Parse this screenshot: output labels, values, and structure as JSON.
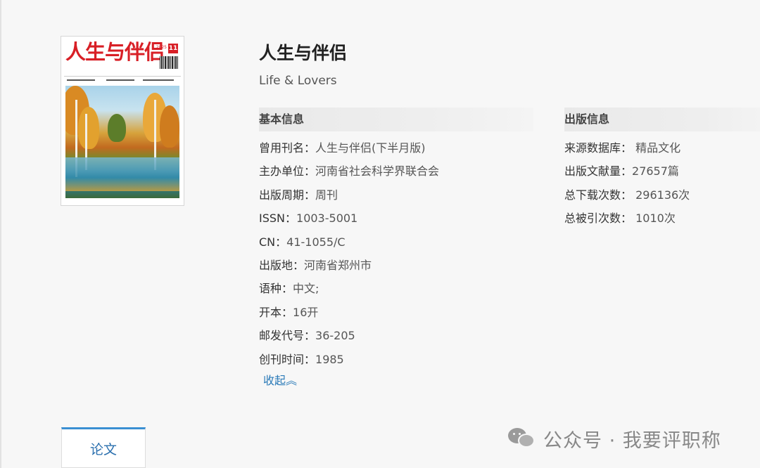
{
  "cover": {
    "masthead": "人生与伴侣",
    "issue": "11",
    "year": "2025"
  },
  "journal": {
    "title": "人生与伴侣",
    "english_title": "Life & Lovers"
  },
  "basic_info": {
    "heading": "基本信息",
    "items": [
      {
        "label": "曾用刊名：",
        "value": "人生与伴侣(下半月版)"
      },
      {
        "label": "主办单位：",
        "value": "河南省社会科学界联合会"
      },
      {
        "label": "出版周期：",
        "value": "周刊"
      },
      {
        "label": "ISSN：",
        "value": "1003-5001"
      },
      {
        "label": "CN：",
        "value": "41-1055/C"
      },
      {
        "label": "出版地：",
        "value": "河南省郑州市"
      },
      {
        "label": "语种：",
        "value": "中文;"
      },
      {
        "label": "开本：",
        "value": "16开"
      },
      {
        "label": "邮发代号：",
        "value": "36-205"
      },
      {
        "label": "创刊时间：",
        "value": "1985"
      }
    ],
    "collapse_label": "收起︽"
  },
  "publish_info": {
    "heading": "出版信息",
    "items": [
      {
        "label": "来源数据库：",
        "value": " 精品文化"
      },
      {
        "label": "出版文献量：",
        "value": "27657篇"
      },
      {
        "label": "总下载次数：",
        "value": " 296136次"
      },
      {
        "label": "总被引次数：",
        "value": " 1010次"
      }
    ]
  },
  "tabs": [
    {
      "label": "论文"
    }
  ],
  "watermark": {
    "icon": "wechat-icon",
    "text": "公众号 · 我要评职称"
  }
}
